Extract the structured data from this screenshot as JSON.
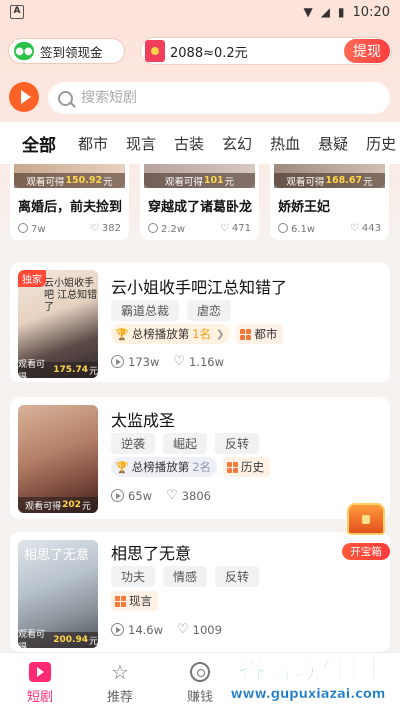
{
  "status_bar": {
    "time": "10:20",
    "app_icon_letter": "A"
  },
  "header": {
    "checkin_label": "签到领现金",
    "coins_text": "2088≈0.2元",
    "withdraw_label": "提现"
  },
  "search": {
    "placeholder": "搜索短剧"
  },
  "tabs": [
    "全部",
    "都市",
    "现言",
    "古装",
    "玄幻",
    "热血",
    "悬疑",
    "历史"
  ],
  "top_cards": [
    {
      "earn_prefix": "观看可得",
      "earn_value": "150.92",
      "earn_unit": "元",
      "title": "离婚后，前夫捡到",
      "views": "7w",
      "likes": "382"
    },
    {
      "earn_prefix": "观看可得",
      "earn_value": "101",
      "earn_unit": "元",
      "title": "穿越成了诸葛卧龙",
      "views": "2.2w",
      "likes": "471"
    },
    {
      "earn_prefix": "观看可得",
      "earn_value": "168.67",
      "earn_unit": "元",
      "title": "娇娇王妃",
      "views": "6.1w",
      "likes": "443"
    }
  ],
  "list_cards": [
    {
      "exclusive": "独家",
      "cover_text": "云小姐收手吧 江总知错了",
      "earn_prefix": "观看可得",
      "earn_value": "175.74",
      "earn_unit": "元",
      "title": "云小姐收手吧江总知错了",
      "tags": [
        "霸道总裁",
        "虐恋"
      ],
      "rank_prefix": "总榜播放第",
      "rank_num": "1名",
      "genre": "都市",
      "views": "173w",
      "likes": "1.16w"
    },
    {
      "exclusive": "",
      "cover_text": "",
      "earn_prefix": "观看可得",
      "earn_value": "202",
      "earn_unit": "元",
      "title": "太监成圣",
      "tags": [
        "逆袭",
        "崛起",
        "反转"
      ],
      "rank_prefix": "总榜播放第",
      "rank_num": "2名",
      "genre": "历史",
      "views": "65w",
      "likes": "3806"
    },
    {
      "exclusive": "",
      "cover_text": "相思了无意",
      "earn_prefix": "观看可得",
      "earn_value": "200.94",
      "earn_unit": "元",
      "title": "相思了无意",
      "tags": [
        "功夫",
        "情感",
        "反转"
      ],
      "genre": "现言",
      "views": "14.6w",
      "likes": "1009"
    }
  ],
  "treasure": {
    "label": "开宝箱"
  },
  "bottom_nav": [
    {
      "label": "短剧",
      "icon": "drama-icon",
      "active": true
    },
    {
      "label": "推荐",
      "icon": "star-icon",
      "active": false
    },
    {
      "label": "赚钱",
      "icon": "coin-icon",
      "active": false
    }
  ],
  "watermark": {
    "title": "谷普软件园",
    "url": "www.gupuxiazai.com"
  },
  "colors": {
    "accent": "#ff2a73",
    "brand_orange": "#ff6227",
    "earn_yellow": "#ffd54a",
    "withdraw_red": "#ff3d3d"
  }
}
